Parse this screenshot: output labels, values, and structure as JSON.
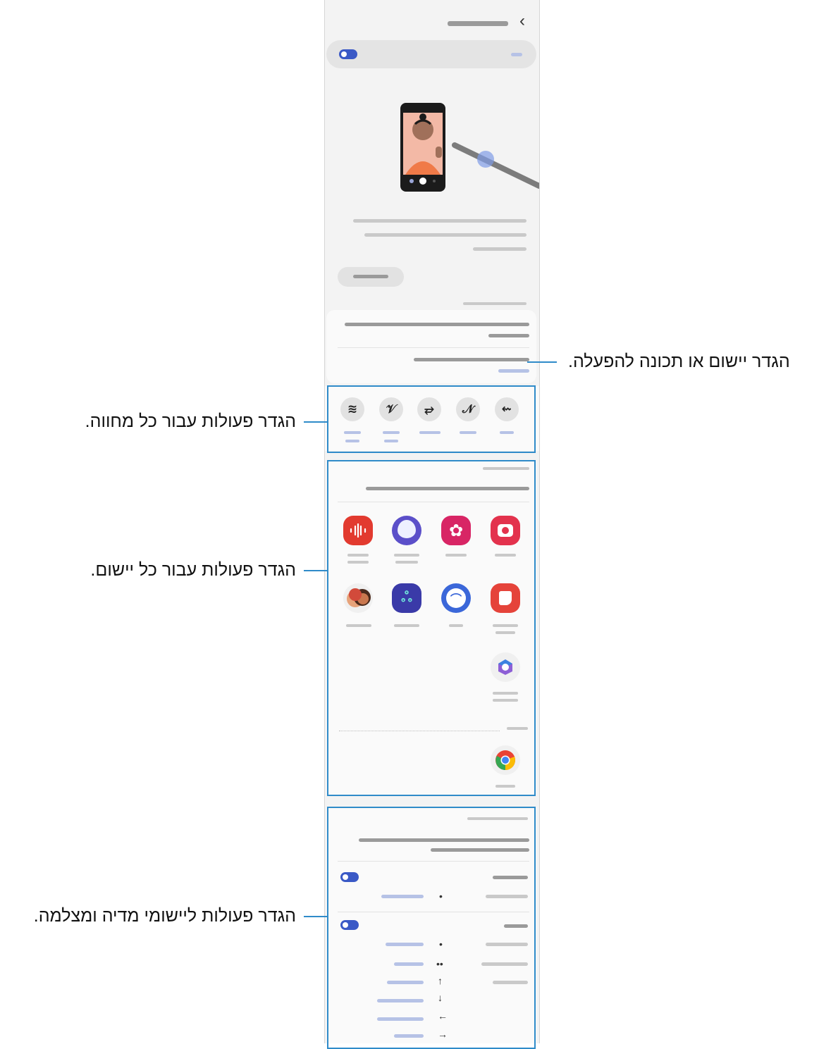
{
  "callouts": {
    "app_or_feature": "הגדר יישום או תכונה להפעלה.",
    "gestures": "הגדר פעולות עבור כל מחווה.",
    "per_app": "הגדר פעולות עבור כל יישום.",
    "media_camera": "הגדר פעולות ליישומי מדיה ומצלמה."
  },
  "icons": {
    "back": "chevron-right-icon",
    "gestures": [
      "stacked-lines-gesture",
      "v-gesture",
      "zigzag-gesture",
      "n-gesture",
      "left-arrow-gesture"
    ],
    "apps_row1": [
      "voice-recorder-icon",
      "internet-icon",
      "gallery-icon",
      "camera-icon"
    ],
    "apps_row2": [
      "ar-emoji-icon",
      "pen-up-icon",
      "bixby-vision-icon",
      "samsung-notes-icon"
    ],
    "apps_row3": [
      "office-icon"
    ],
    "apps_row4": [
      "chrome-icon"
    ]
  },
  "glyphs": {
    "chevron": "‹",
    "single_press": "•",
    "double_press": "••",
    "swipe_up": "↑",
    "swipe_down": "↓",
    "swipe_left": "←",
    "swipe_right": "→"
  },
  "colors": {
    "accent": "#3a59c6",
    "callout": "#2f8bc9"
  }
}
